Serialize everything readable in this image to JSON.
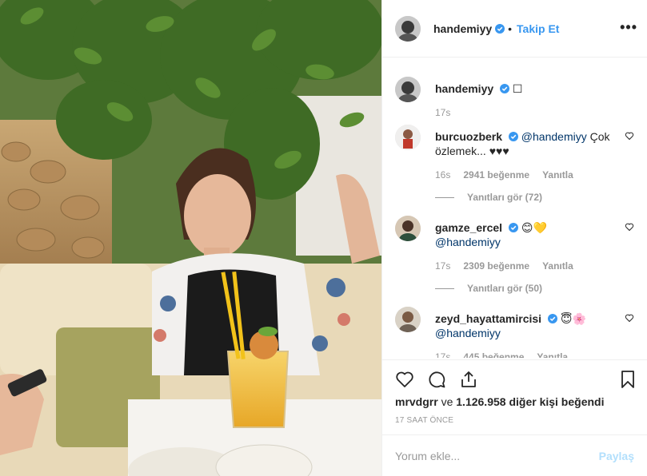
{
  "post": {
    "author": "handemiyy",
    "follow_label": "Takip Et",
    "dot": "•",
    "more_label": "•••",
    "caption_text": "☐",
    "caption_time": "17s"
  },
  "comments": [
    {
      "user": "burcuozberk",
      "mention": "@handemiyy",
      "text": " Çok özlemek... ♥♥♥",
      "time": "16s",
      "likes": "2941 beğenme",
      "reply": "Yanıtla",
      "view_replies": "Yanıtları gör (72)"
    },
    {
      "user": "gamze_ercel",
      "emoji": "😊💛",
      "mention": "@handemiyy",
      "text": "",
      "time": "17s",
      "likes": "2309 beğenme",
      "reply": "Yanıtla",
      "view_replies": "Yanıtları gör (50)"
    },
    {
      "user": "zeyd_hayattamircisi",
      "emoji": "😇🌸",
      "mention": "@handemiyy",
      "text": "",
      "time": "17s",
      "likes": "445 beğenme",
      "reply": "Yanıtla"
    }
  ],
  "likes_line": {
    "user": "mrvdgrr",
    "mid": " ve ",
    "count": "1.126.958",
    "rest": " diğer kişi beğendi"
  },
  "timestamp": "17 SAAT ÖNCE",
  "comment_input": {
    "placeholder": "Yorum ekle...",
    "post_label": "Paylaş"
  },
  "colors": {
    "link": "#3897f0",
    "mention": "#003569",
    "verified": "#3897f0",
    "muted": "#999999"
  },
  "icons": [
    "more-icon",
    "verified-icon",
    "heart-icon",
    "comment-icon",
    "share-icon",
    "bookmark-icon"
  ]
}
